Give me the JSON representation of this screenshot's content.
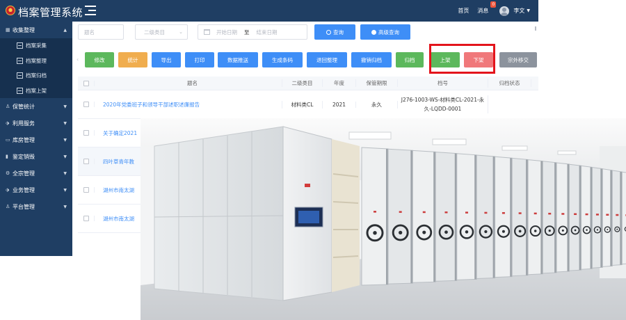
{
  "header": {
    "app_title": "档案管理系统",
    "home": "首页",
    "messages": "消息",
    "message_count": "0",
    "user_name": "李文"
  },
  "sidebar": {
    "groups": [
      {
        "label": "收集整理",
        "icon": "grid-icon",
        "expanded": true,
        "items": [
          "档案采集",
          "档案整理",
          "档案归档",
          "档案上架"
        ]
      },
      {
        "label": "保管统计",
        "icon": "user-icon"
      },
      {
        "label": "利用服务",
        "icon": "tag-icon"
      },
      {
        "label": "库房管理",
        "icon": "folder-icon"
      },
      {
        "label": "鉴定销毁",
        "icon": "bar-chart-icon"
      },
      {
        "label": "全宗管理",
        "icon": "gear-icon"
      },
      {
        "label": "业务管理",
        "icon": "tag-icon"
      },
      {
        "label": "平台管理",
        "icon": "user-icon"
      }
    ]
  },
  "filters": {
    "title_placeholder": "题名",
    "category_placeholder": "二级类目",
    "start_date_placeholder": "开始日期",
    "date_separator": "至",
    "end_date_placeholder": "结束日期",
    "query_label": "查询",
    "advanced_query_label": "高级查询"
  },
  "toolbar": {
    "buttons": [
      {
        "label": "修改",
        "color": "#5cb85c"
      },
      {
        "label": "统计",
        "color": "#f0ad4e"
      },
      {
        "label": "导出",
        "color": "#3e8ef7"
      },
      {
        "label": "打印",
        "color": "#3e8ef7"
      },
      {
        "label": "数据推送",
        "color": "#3e8ef7"
      },
      {
        "label": "生成条码",
        "color": "#3e8ef7"
      },
      {
        "label": "退回整理",
        "color": "#3e8ef7"
      },
      {
        "label": "撤销归档",
        "color": "#3e8ef7"
      },
      {
        "label": "归档",
        "color": "#5cb85c"
      },
      {
        "label": "上架",
        "color": "#5cb85c"
      },
      {
        "label": "下架",
        "color": "#f0787a"
      },
      {
        "label": "宗外移交",
        "color": "#8c939d"
      }
    ]
  },
  "table": {
    "headers": [
      "题名",
      "二级类目",
      "年度",
      "保管期限",
      "档号",
      "归档状态"
    ],
    "rows": [
      {
        "title": "2020年党委班子和领导干部述职述廉报告",
        "category": "材料类CL",
        "year": "2021",
        "period": "永久",
        "code": "J276-1003-WS-材料类CL-2021-永久-LQDD-0001",
        "status": ""
      },
      {
        "title": "关于确定2021",
        "category": "",
        "year": "",
        "period": "",
        "code": "",
        "status": ""
      },
      {
        "title": "四叶草青年教",
        "category": "",
        "year": "",
        "period": "",
        "code": "",
        "status": ""
      },
      {
        "title": "湖州市南太湖",
        "category": "",
        "year": "",
        "period": "",
        "code": "",
        "status": ""
      },
      {
        "title": "湖州市南太湖",
        "category": "",
        "year": "",
        "period": "",
        "code": "",
        "status": ""
      }
    ]
  },
  "colors": {
    "nav_background": "#1f3e63",
    "primary": "#3e8ef7",
    "highlight_border": "#e3141c"
  }
}
